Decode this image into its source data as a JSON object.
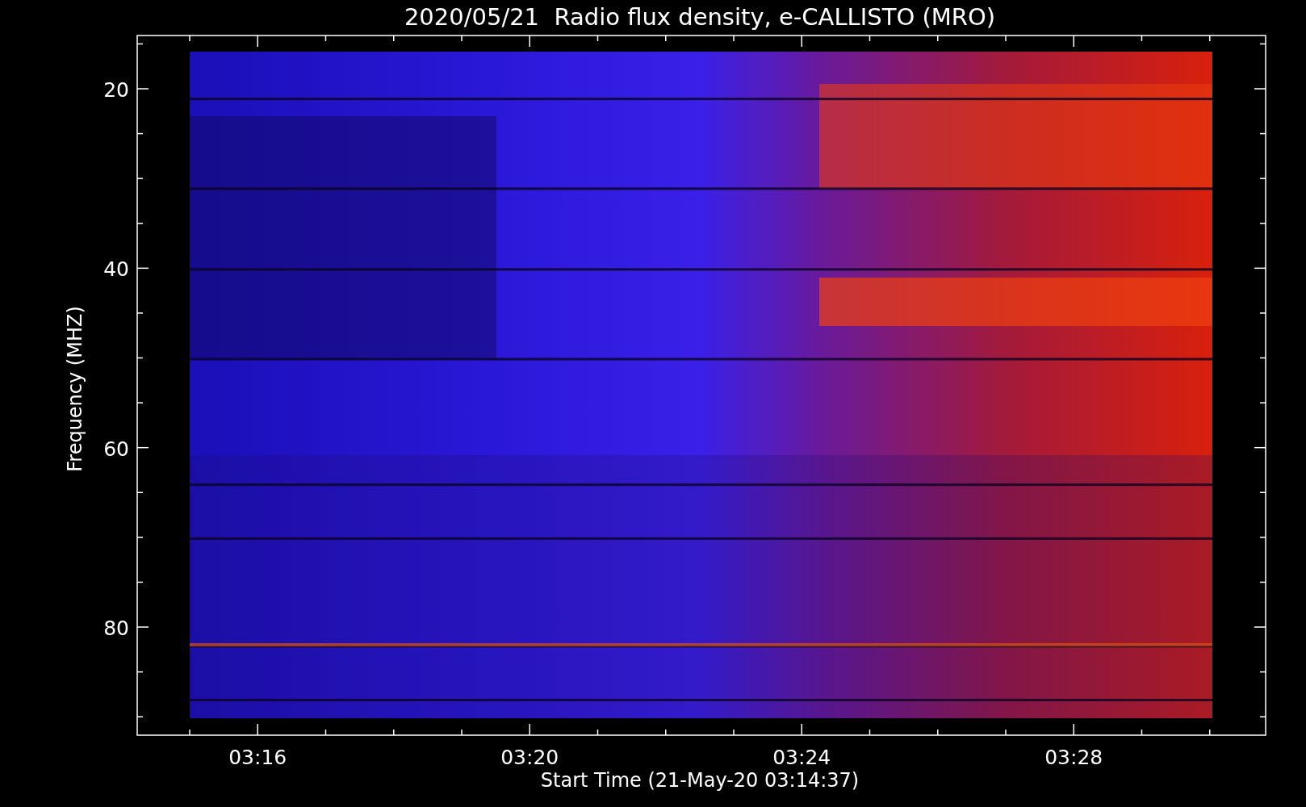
{
  "plot": {
    "title": "2020/05/21  Radio flux density, e-CALLISTO (MRO)",
    "xlabel": "Start Time (21-May-20 03:14:37)",
    "ylabel": "Frequency (MHZ)",
    "yticks": [
      "20",
      "40",
      "60",
      "80"
    ],
    "xticks": [
      "03:16",
      "03:20",
      "03:24",
      "03:28"
    ]
  }
}
